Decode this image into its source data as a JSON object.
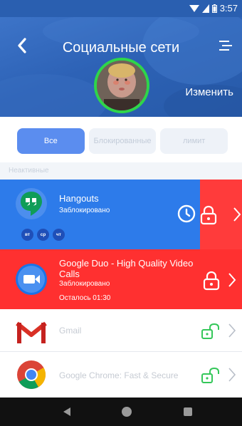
{
  "status_bar": {
    "time": "3:57"
  },
  "header": {
    "title": "Социальные сети",
    "edit_label": "Изменить"
  },
  "tabs": [
    {
      "label": "Все",
      "active": true
    },
    {
      "label": "Блокированные",
      "active": false
    },
    {
      "label": "лимит",
      "active": false
    }
  ],
  "section_label": "Неактивные",
  "apps": {
    "hangouts": {
      "name": "Hangouts",
      "status": "Заблокировано",
      "days": [
        "вт",
        "ср",
        "чт"
      ]
    },
    "duo": {
      "name": "Google Duo - High Quality Video Calls",
      "status": "Заблокировано",
      "remaining": "Осталось 01:30"
    },
    "gmail": {
      "name": "Gmail"
    },
    "chrome": {
      "name": "Google Chrome: Fast & Secure"
    }
  },
  "colors": {
    "header": "#2d62b6",
    "tab_active": "#5b8def",
    "row_blocked_blue": "#2d7bea",
    "row_blocked_red": "#ff3030",
    "lock_green": "#34c759"
  },
  "icons": [
    "back-arrow-icon",
    "menu-icon",
    "clock-icon",
    "lock-icon",
    "unlock-icon",
    "chevron-right-icon"
  ]
}
